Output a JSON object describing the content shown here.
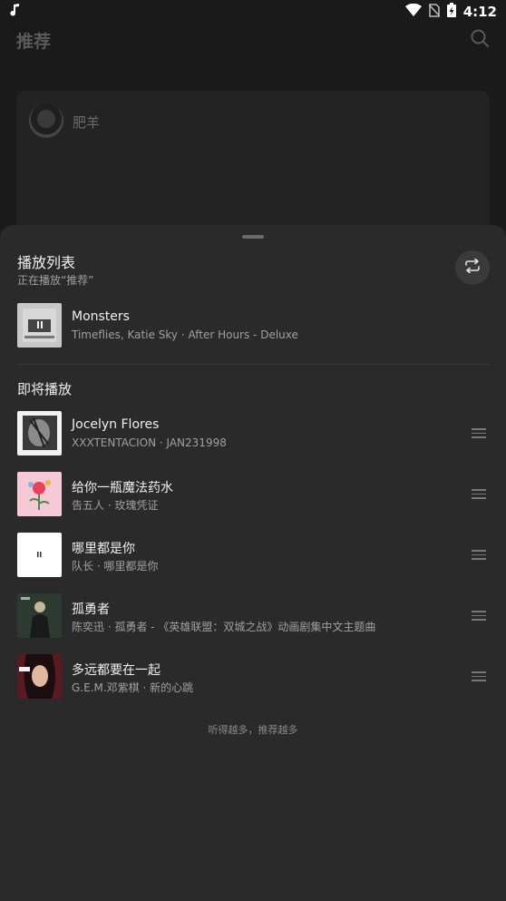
{
  "status_bar": {
    "time": "4:12"
  },
  "background_page": {
    "title": "推荐",
    "card": {
      "username": "肥羊"
    }
  },
  "playlist": {
    "title": "播放列表",
    "subtitle": "正在播放“推荐”",
    "repeat_icon": "repeat-icon",
    "now_playing": {
      "title": "Monsters",
      "subtitle": "Timeflies, Katie Sky · After Hours - Deluxe"
    },
    "up_next_heading": "即将播放",
    "queue": [
      {
        "title": "Jocelyn Flores",
        "subtitle": "XXXTENTACION · JAN231998"
      },
      {
        "title": "给你一瓶魔法药水",
        "subtitle": "告五人 · 玫瑰凭证"
      },
      {
        "title": "哪里都是你",
        "subtitle": "队长 · 哪里都是你"
      },
      {
        "title": "孤勇者",
        "subtitle": "陈奕迅 · 孤勇者 - 《英雄联盟：双城之战》动画剧集中文主题曲"
      },
      {
        "title": "多远都要在一起",
        "subtitle": "G.E.M.邓紫棋 · 新的心跳"
      }
    ],
    "footer_note": "听得越多，推荐越多"
  }
}
